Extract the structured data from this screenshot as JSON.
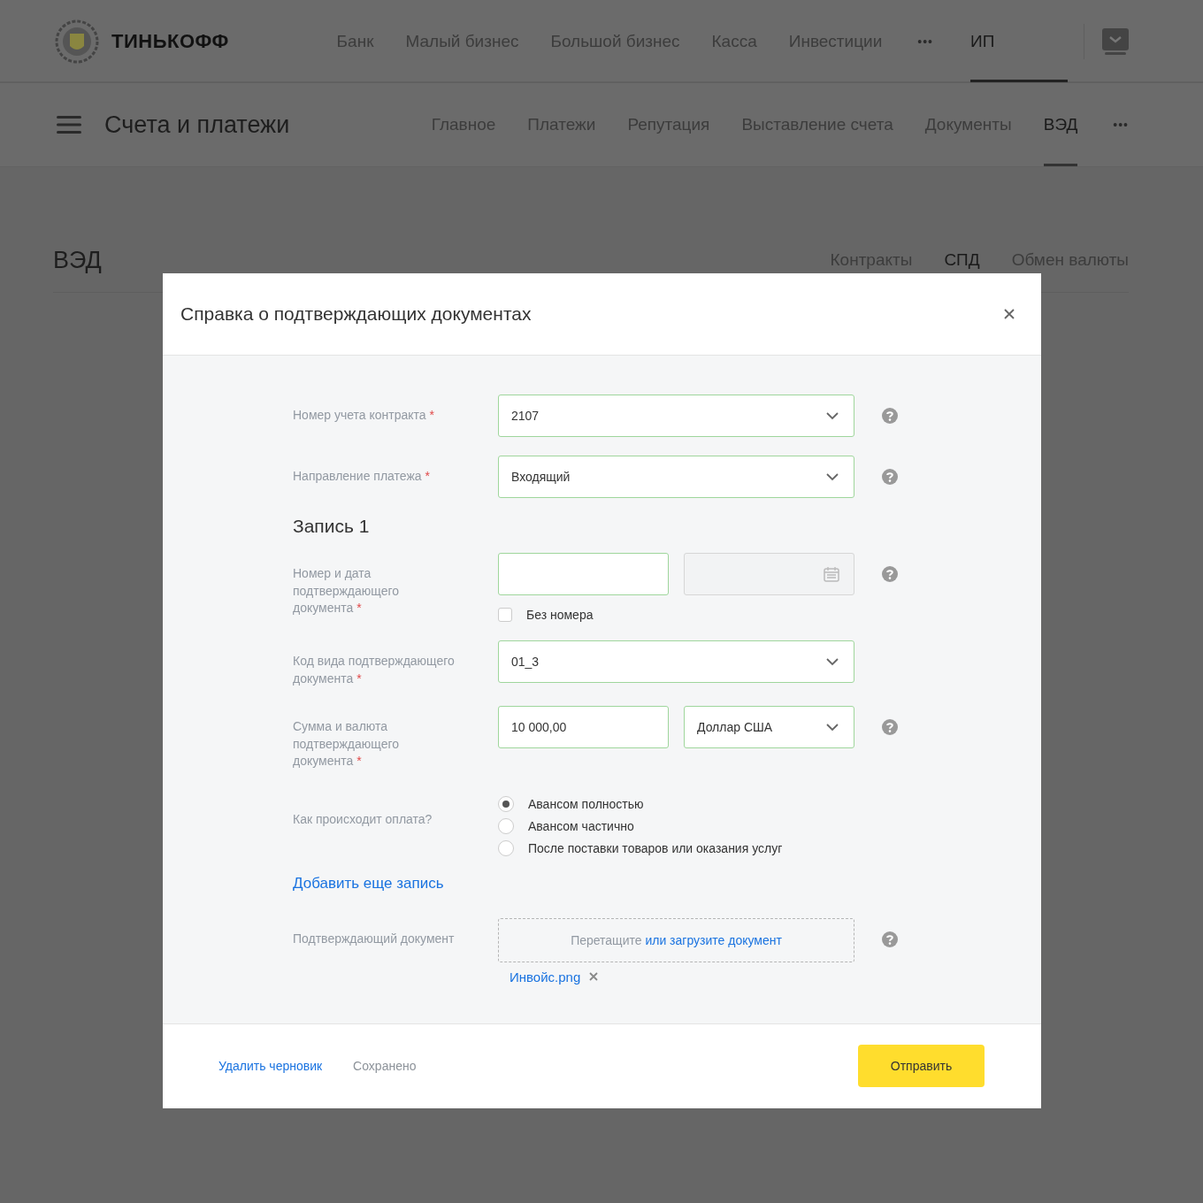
{
  "header": {
    "logo_text": "ТИНЬКОФФ",
    "nav": [
      {
        "label": "Банк"
      },
      {
        "label": "Малый бизнес"
      },
      {
        "label": "Большой бизнес"
      },
      {
        "label": "Касса"
      },
      {
        "label": "Инвестиции"
      }
    ],
    "more": "•••",
    "account": {
      "label": "ИП",
      "selected": true
    }
  },
  "subheader": {
    "title": "Счета и платежи",
    "tabs": [
      {
        "label": "Главное",
        "selected": false
      },
      {
        "label": "Платежи",
        "selected": false
      },
      {
        "label": "Репутация",
        "selected": false
      },
      {
        "label": "Выставление счета",
        "selected": false
      },
      {
        "label": "Документы",
        "selected": false
      },
      {
        "label": "ВЭД",
        "selected": true
      }
    ],
    "more": "•••"
  },
  "page": {
    "title": "ВЭД",
    "tabs": [
      {
        "label": "Контракты",
        "selected": false
      },
      {
        "label": "СПД",
        "selected": true
      },
      {
        "label": "Обмен валюты",
        "selected": false
      }
    ]
  },
  "dialog": {
    "title": "Справка о подтверждающих документах",
    "rows": [
      {
        "kind": "select",
        "label": "Номер учета контракта",
        "required_mark": "*",
        "value": "2107",
        "help": true
      },
      {
        "kind": "select",
        "label": "Направление платежа",
        "required_mark": "*",
        "value": "Входящий",
        "help": true
      },
      {
        "kind": "heading",
        "text": "Запись 1"
      },
      {
        "kind": "number-date",
        "label": "Номер и дата\nподтверждающего\nдокумента",
        "required_mark": "*",
        "help": true,
        "checkbox": {
          "label": "Без номера",
          "checked": false
        }
      },
      {
        "kind": "select",
        "label": "Код вида подтверждающего\nдокумента",
        "required_mark": "*",
        "value": "01_3",
        "help": false
      },
      {
        "kind": "amount-currency",
        "label": "Сумма и валюта\nподтверждающего\nдокумента",
        "required_mark": "*",
        "amount": "10 000,00",
        "currency": "Доллар США",
        "help": true
      },
      {
        "kind": "radio",
        "label": "Как происходит оплата?",
        "options": [
          {
            "label": "Авансом полностью",
            "selected": true
          },
          {
            "label": "Авансом частично",
            "selected": false
          },
          {
            "label": "После поставки товаров или оказания услуг",
            "selected": false
          }
        ]
      },
      {
        "kind": "link",
        "text": "Добавить еще запись"
      },
      {
        "kind": "file",
        "label": "Подтверждающий документ",
        "hint": "Перетащите",
        "link": "или загрузите документ",
        "help": true,
        "files": [
          {
            "name": "Инвойс.png"
          }
        ]
      }
    ],
    "footer": {
      "delete": "Удалить черновик",
      "status": "Сохранено",
      "submit": "Отправить"
    }
  }
}
